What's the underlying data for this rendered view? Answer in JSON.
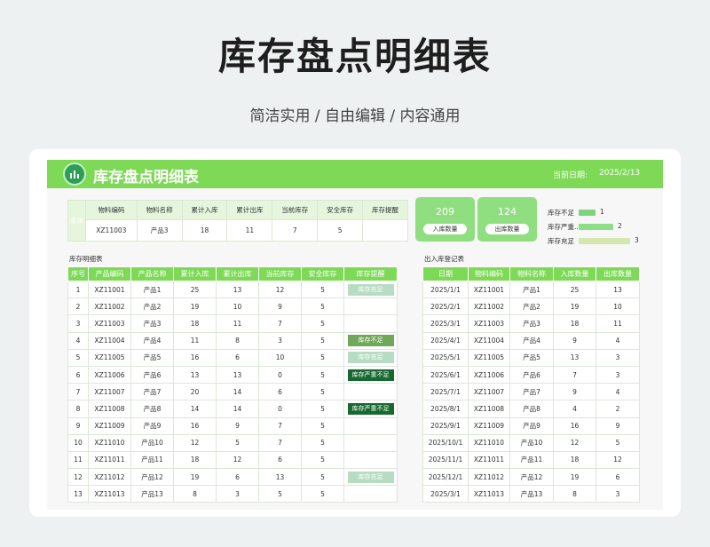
{
  "page": {
    "title": "库存盘点明细表",
    "subtitle": "简洁实用 / 自由编辑 / 内容通用"
  },
  "sheet": {
    "banner_title": "库存盘点明细表",
    "date_label": "当前日期:",
    "date_value": "2025/2/13"
  },
  "query": {
    "label": "查询",
    "headers": [
      "物料编码",
      "物料名称",
      "累计入库",
      "累计出库",
      "当前库存",
      "安全库存",
      "库存提醒"
    ],
    "values": [
      "XZ11003",
      "产品3",
      "18",
      "11",
      "7",
      "5",
      ""
    ]
  },
  "stats": [
    {
      "value": "209",
      "label": "入库数量"
    },
    {
      "value": "124",
      "label": "出库数量"
    }
  ],
  "mini_chart": {
    "type": "bar",
    "categories": [
      "库存不足",
      "库存严重...",
      "库存充足"
    ],
    "values": [
      1,
      2,
      3
    ],
    "colors": [
      "#7fd37d",
      "#8ede88",
      "#d5e6b0"
    ]
  },
  "detail": {
    "section_title": "库存明细表",
    "headers": [
      "序号",
      "产品编码",
      "产品名称",
      "累计入库",
      "累计出库",
      "当前库存",
      "安全库存",
      "库存提醒"
    ],
    "rows": [
      [
        "1",
        "XZ11001",
        "产品1",
        "25",
        "13",
        "12",
        "5",
        "库存充足"
      ],
      [
        "2",
        "XZ11002",
        "产品2",
        "19",
        "10",
        "9",
        "5",
        ""
      ],
      [
        "3",
        "XZ11003",
        "产品3",
        "18",
        "11",
        "7",
        "5",
        ""
      ],
      [
        "4",
        "XZ11004",
        "产品4",
        "11",
        "8",
        "3",
        "5",
        "库存不足"
      ],
      [
        "5",
        "XZ11005",
        "产品5",
        "16",
        "6",
        "10",
        "5",
        "库存充足"
      ],
      [
        "6",
        "XZ11006",
        "产品6",
        "13",
        "13",
        "0",
        "5",
        "库存严重不足"
      ],
      [
        "7",
        "XZ11007",
        "产品7",
        "20",
        "14",
        "6",
        "5",
        ""
      ],
      [
        "8",
        "XZ11008",
        "产品8",
        "14",
        "14",
        "0",
        "5",
        "库存严重不足"
      ],
      [
        "9",
        "XZ11009",
        "产品9",
        "16",
        "9",
        "7",
        "5",
        ""
      ],
      [
        "10",
        "XZ11010",
        "产品10",
        "12",
        "5",
        "7",
        "5",
        ""
      ],
      [
        "11",
        "XZ11011",
        "产品11",
        "18",
        "12",
        "6",
        "5",
        ""
      ],
      [
        "12",
        "XZ11012",
        "产品12",
        "19",
        "6",
        "13",
        "5",
        "库存充足"
      ],
      [
        "13",
        "XZ11013",
        "产品13",
        "8",
        "3",
        "5",
        "5",
        ""
      ]
    ]
  },
  "ledger": {
    "section_title": "出入库登记表",
    "headers": [
      "日期",
      "物料编码",
      "物料名称",
      "入库数量",
      "出库数量"
    ],
    "rows": [
      [
        "2025/1/1",
        "XZ11001",
        "产品1",
        "25",
        "13"
      ],
      [
        "2025/2/1",
        "XZ11002",
        "产品2",
        "19",
        "10"
      ],
      [
        "2025/3/1",
        "XZ11003",
        "产品3",
        "18",
        "11"
      ],
      [
        "2025/4/1",
        "XZ11004",
        "产品4",
        "9",
        "4"
      ],
      [
        "2025/5/1",
        "XZ11005",
        "产品5",
        "13",
        "3"
      ],
      [
        "2025/6/1",
        "XZ11006",
        "产品6",
        "7",
        "3"
      ],
      [
        "2025/7/1",
        "XZ11007",
        "产品7",
        "9",
        "4"
      ],
      [
        "2025/8/1",
        "XZ11008",
        "产品8",
        "4",
        "2"
      ],
      [
        "2025/9/1",
        "XZ11009",
        "产品9",
        "16",
        "9"
      ],
      [
        "2025/10/1",
        "XZ11010",
        "产品10",
        "12",
        "5"
      ],
      [
        "2025/11/1",
        "XZ11011",
        "产品11",
        "18",
        "12"
      ],
      [
        "2025/12/1",
        "XZ11012",
        "产品12",
        "19",
        "6"
      ],
      [
        "2025/3/1",
        "XZ11013",
        "产品13",
        "8",
        "3"
      ]
    ]
  },
  "warn_styles": {
    "库存充足": "ok",
    "库存不足": "low",
    "库存严重不足": "severe"
  }
}
